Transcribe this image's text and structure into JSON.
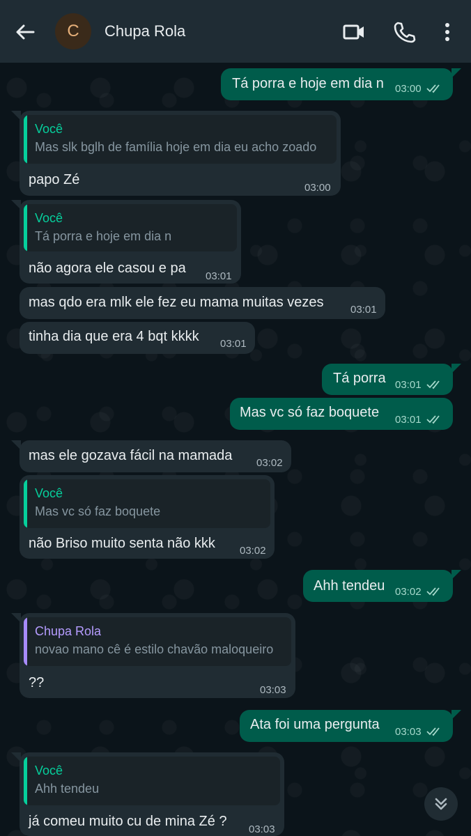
{
  "header": {
    "avatar_letter": "C",
    "contact_name": "Chupa Rola",
    "icons": [
      "back-arrow-icon",
      "video-call-icon",
      "phone-icon",
      "more-vertical-icon"
    ]
  },
  "messages": [
    {
      "text": "Tá porra e hoje em dia n",
      "time": "03:00"
    },
    {
      "quote_name": "Você",
      "quote_text": "Mas slk bglh de família hoje em dia eu acho zoado",
      "text": "papo Zé",
      "time": "03:00"
    },
    {
      "quote_name": "Você",
      "quote_text": "Tá porra e hoje em dia n",
      "text": "não agora ele casou e pa",
      "time": "03:01"
    },
    {
      "text": "mas qdo era mlk ele fez eu mama muitas vezes",
      "time": "03:01"
    },
    {
      "text": "tinha dia que era 4 bqt kkkk",
      "time": "03:01"
    },
    {
      "text": "Tá porra",
      "time": "03:01"
    },
    {
      "text": "Mas vc só faz boquete",
      "time": "03:01"
    },
    {
      "text": "mas ele gozava fácil na mamada",
      "time": "03:02"
    },
    {
      "quote_name": "Você",
      "quote_text": "Mas vc só faz boquete",
      "text": "não Briso muito senta não kkk",
      "time": "03:02"
    },
    {
      "text": "Ahh tendeu",
      "time": "03:02"
    },
    {
      "quote_name": "Chupa Rola",
      "quote_text": "novao mano cê é estilo chavão maloqueiro",
      "text": "??",
      "time": "03:03"
    },
    {
      "text": "Ata foi uma pergunta",
      "time": "03:03"
    },
    {
      "quote_name": "Você",
      "quote_text": "Ahh tendeu",
      "text": "já comeu muito cu de mina Zé ?",
      "time": "03:03"
    }
  ],
  "colors": {
    "header_bg": "#1f2c34",
    "incoming_bubble": "#202c33",
    "outgoing_bubble": "#005c4b",
    "quote_accent": "#06cf9c",
    "quote_accent_contact": "#a78bfa"
  }
}
